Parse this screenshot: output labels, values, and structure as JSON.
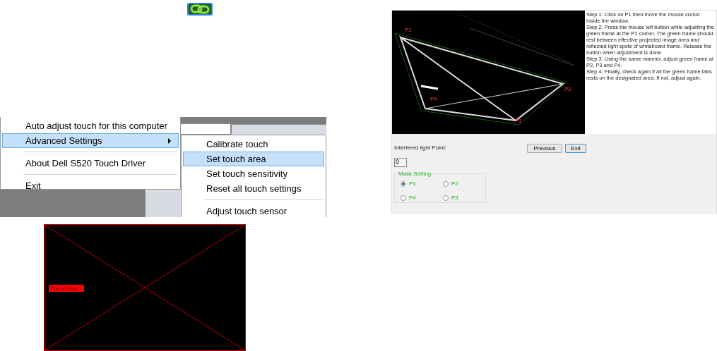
{
  "tray_icon": {
    "kind": "link"
  },
  "context_menu": {
    "items": [
      {
        "kind": "item",
        "label": "Auto adjust touch for this computer",
        "selected": false,
        "submenu": false
      },
      {
        "kind": "item",
        "label": "Advanced Settings",
        "selected": true,
        "submenu": true
      },
      {
        "kind": "separator"
      },
      {
        "kind": "item",
        "label": "About Dell S520 Touch Driver",
        "selected": false,
        "submenu": false
      },
      {
        "kind": "separator"
      },
      {
        "kind": "item",
        "label": "Exit",
        "selected": false,
        "submenu": false
      }
    ]
  },
  "submenu": {
    "items": [
      {
        "kind": "item",
        "label": "Calibrate touch",
        "selected": false
      },
      {
        "kind": "item",
        "label": "Set touch area",
        "selected": true
      },
      {
        "kind": "item",
        "label": "Set touch sensitivity",
        "selected": false
      },
      {
        "kind": "item",
        "label": "Reset all touch settings",
        "selected": false
      },
      {
        "kind": "separator"
      },
      {
        "kind": "item",
        "label": "Adjust touch sensor",
        "selected": false
      }
    ]
  },
  "processing_screen": {
    "status": "Processing..."
  },
  "touch_area_window": {
    "camera_view": {
      "corners": [
        {
          "label": "P1"
        },
        {
          "label": "P2"
        },
        {
          "label": "P3"
        },
        {
          "label": "P4"
        }
      ]
    },
    "instructions": [
      "Step 1: Click on P1 then move the mouse cursor inside the window.",
      "Step 2: Press the mouse left button while adjusting the green frame at the P1 corner. The green frame should rest between effective projected image area and reflected light spots of whiteboard frame. Release the button when adjustment is done.",
      "Step 3: Using the same manner, adjust green frame at P2, P3 and P4.",
      "Step 4: Finally, check again if all the green frame tabs rests on the designated area. If not, adjust again."
    ],
    "interfered_light": {
      "label": "Interfered light Point:",
      "value": "0"
    },
    "buttons": [
      "Previous",
      "Exit"
    ],
    "mask_setting": {
      "title": "Mask Setting",
      "options": [
        {
          "label": "P1",
          "selected": true
        },
        {
          "label": "P2",
          "selected": false
        },
        {
          "label": "P4",
          "selected": false
        },
        {
          "label": "P3",
          "selected": false
        }
      ]
    }
  }
}
